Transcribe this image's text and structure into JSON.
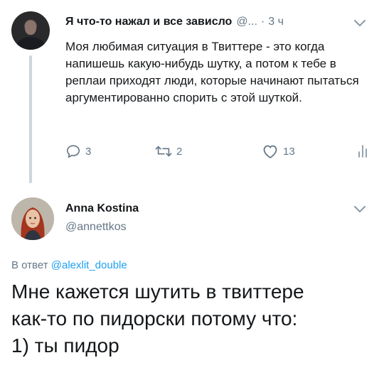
{
  "colors": {
    "text": "#14171a",
    "secondary": "#657786",
    "link": "#1da1f2",
    "thread_line": "#ccd6dd"
  },
  "tweet1": {
    "author_name": "Я что-то нажал и все зависло",
    "handle": "@...",
    "separator": "·",
    "time": "3 ч",
    "text": "Моя любимая ситуация в Твиттере - это когда напишешь какую-нибудь шутку, а потом к тебе в реплаи приходят люди, которые начинают пытаться аргументированно спорить с этой шуткой.",
    "actions": {
      "reply_icon": "reply-icon",
      "reply_count": "3",
      "retweet_icon": "retweet-icon",
      "retweet_count": "2",
      "like_icon": "heart-icon",
      "like_count": "13",
      "analytics_icon": "analytics-icon"
    },
    "menu_icon": "chevron-down-icon"
  },
  "tweet2": {
    "author_name": "Anna Kostina",
    "handle": "@annettkos",
    "menu_icon": "chevron-down-icon",
    "reply_prefix": "В ответ",
    "reply_mention": "@alexlit_double",
    "text_line1": "Мне кажется шутить в твиттере",
    "text_line2": "как-то по пидорски потому что:",
    "text_line3": "1) ты пидор"
  }
}
